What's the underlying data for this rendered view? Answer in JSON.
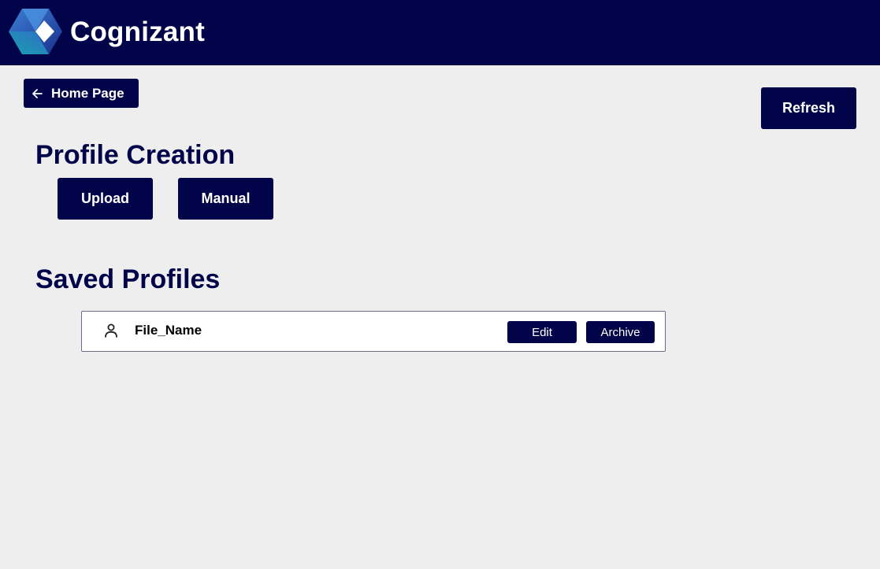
{
  "header": {
    "brand": "Cognizant",
    "logo_icon": "cognizant-logo-icon",
    "background": "#010449"
  },
  "nav": {
    "home_label": "Home Page",
    "home_icon": "arrow-left-icon",
    "refresh_label": "Refresh"
  },
  "profile_creation": {
    "title": "Profile Creation",
    "upload_label": "Upload",
    "manual_label": "Manual"
  },
  "saved_profiles": {
    "title": "Saved Profiles",
    "items": [
      {
        "icon": "user-icon",
        "name": "File_Name",
        "edit_label": "Edit",
        "archive_label": "Archive"
      }
    ]
  },
  "colors": {
    "accent": "#010449",
    "page_background": "#eeeeee",
    "row_background": "#ffffff"
  }
}
